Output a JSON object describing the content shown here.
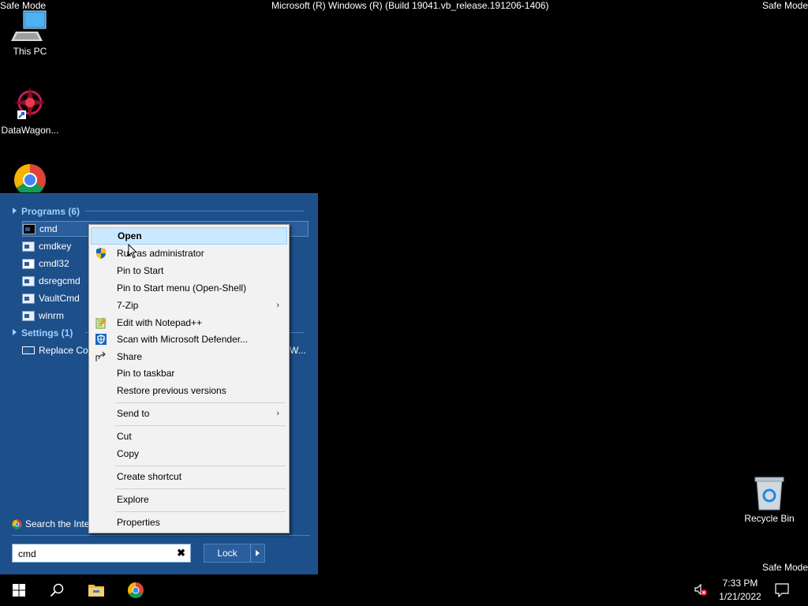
{
  "watermark": {
    "top_left": "Safe Mode",
    "top_center": "Microsoft (R) Windows (R) (Build 19041.vb_release.191206-1406)",
    "top_right": "Safe Mode",
    "bottom_right": "Safe Mode"
  },
  "desktop": {
    "icons": [
      {
        "label": "This PC",
        "icon": "monitor-icon"
      },
      {
        "label": "DataWagon...",
        "icon": "datawagon-shortcut-icon"
      },
      {
        "label": "",
        "icon": "chrome-icon"
      },
      {
        "label": "Recycle Bin",
        "icon": "recycle-bin-icon"
      }
    ]
  },
  "start_menu": {
    "programs_header": "Programs (6)",
    "programs": [
      "cmd",
      "cmdkey",
      "cmdl32",
      "dsregcmd",
      "VaultCmd",
      "winrm"
    ],
    "settings_header": "Settings (1)",
    "settings": [
      "Replace Cor",
      "W..."
    ],
    "search_internet": "Search the Inte",
    "search_value": "cmd",
    "search_clear": "✖",
    "lock_label": "Lock"
  },
  "context_menu": {
    "items": [
      {
        "label": "Open",
        "bold": true,
        "highlighted": true
      },
      {
        "label": "Run as administrator",
        "icon": "shield-icon"
      },
      {
        "label": "Pin to Start"
      },
      {
        "label": "Pin to Start menu (Open-Shell)"
      },
      {
        "label": "7-Zip",
        "submenu": true
      },
      {
        "label": "Edit with Notepad++",
        "icon": "notepad-plus-icon"
      },
      {
        "label": "Scan with Microsoft Defender...",
        "icon": "defender-icon"
      },
      {
        "label": "Share",
        "icon": "share-icon"
      },
      {
        "label": "Pin to taskbar"
      },
      {
        "label": "Restore previous versions"
      },
      {
        "label": "Send to",
        "submenu": true
      },
      {
        "label": "Cut"
      },
      {
        "label": "Copy"
      },
      {
        "label": "Create shortcut"
      },
      {
        "label": "Explore"
      },
      {
        "label": "Properties"
      }
    ],
    "submenu_arrow": "›"
  },
  "taskbar": {
    "time": "7:33 PM",
    "date": "1/21/2022"
  },
  "colors": {
    "start_menu_bg": "#1d4f8a",
    "highlight": "#cce8ff",
    "header_text": "#9fd0ff"
  }
}
